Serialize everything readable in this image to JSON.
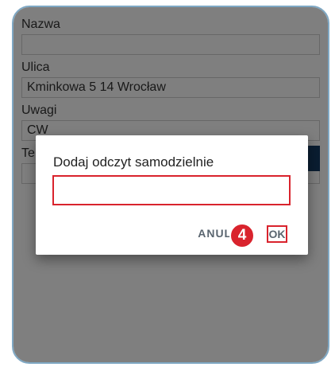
{
  "form": {
    "name_label": "Nazwa",
    "name_value": "",
    "street_label": "Ulica",
    "street_value": "Kminkowa 5 14 Wrocław",
    "notes_label": "Uwagi",
    "notes_value": "CW",
    "fourth_label": "Te",
    "fourth_value": ""
  },
  "dialog": {
    "title": "Dodaj odczyt samodzielnie",
    "input_value": "",
    "cancel_label": "ANULUJ",
    "ok_label": "OK"
  },
  "annotation": {
    "step_number": "4",
    "highlight_color": "#d9232d"
  },
  "colors": {
    "frame_border": "#7fa8c4",
    "dark_button": "#153b63"
  }
}
